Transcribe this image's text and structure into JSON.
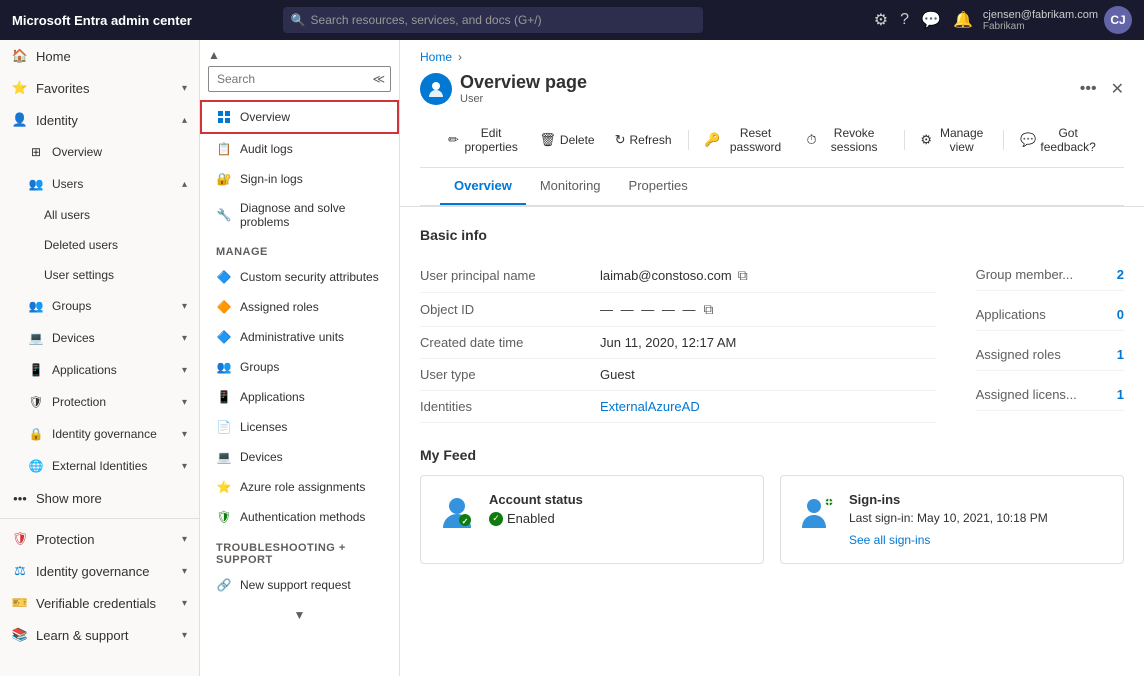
{
  "app": {
    "title": "Microsoft Entra admin center"
  },
  "topbar": {
    "title": "Microsoft Entra admin center",
    "search_placeholder": "Search resources, services, and docs (G+/)",
    "user_name": "cjensen@fabrikam.com",
    "user_org": "Fabrikam",
    "user_initials": "CJ"
  },
  "sidebar": {
    "items": [
      {
        "id": "home",
        "label": "Home",
        "icon": "home",
        "active": false
      },
      {
        "id": "favorites",
        "label": "Favorites",
        "icon": "star",
        "expandable": true
      },
      {
        "id": "identity",
        "label": "Identity",
        "icon": "id",
        "expandable": true,
        "expanded": true
      },
      {
        "id": "overview",
        "label": "Overview",
        "icon": "grid",
        "sub": true
      },
      {
        "id": "users",
        "label": "Users",
        "icon": "person",
        "expandable": true,
        "expanded": true,
        "sub": true
      },
      {
        "id": "all-users",
        "label": "All users",
        "sub2": true
      },
      {
        "id": "deleted-users",
        "label": "Deleted users",
        "sub2": true
      },
      {
        "id": "user-settings",
        "label": "User settings",
        "sub2": true
      },
      {
        "id": "groups",
        "label": "Groups",
        "icon": "group",
        "expandable": true,
        "sub": true
      },
      {
        "id": "devices",
        "label": "Devices",
        "icon": "device",
        "expandable": true,
        "sub": true
      },
      {
        "id": "applications",
        "label": "Applications",
        "icon": "app",
        "expandable": true,
        "sub": true
      },
      {
        "id": "protection",
        "label": "Protection",
        "icon": "shield",
        "expandable": true,
        "sub": true
      },
      {
        "id": "identity-governance",
        "label": "Identity governance",
        "icon": "gov",
        "expandable": true,
        "sub": true
      },
      {
        "id": "external-identities",
        "label": "External Identities",
        "icon": "ext",
        "expandable": true,
        "sub": true
      },
      {
        "id": "show-more",
        "label": "Show more",
        "icon": "more"
      },
      {
        "id": "protection2",
        "label": "Protection",
        "icon": "shield2",
        "expandable": true
      },
      {
        "id": "identity-governance2",
        "label": "Identity governance",
        "icon": "gov2",
        "expandable": true
      },
      {
        "id": "verifiable-credentials",
        "label": "Verifiable credentials",
        "icon": "cred",
        "expandable": true
      },
      {
        "id": "learn-support",
        "label": "Learn & support",
        "icon": "learn",
        "expandable": true
      }
    ]
  },
  "secondary_nav": {
    "search_placeholder": "Search",
    "items": [
      {
        "id": "overview",
        "label": "Overview",
        "selected": true,
        "highlighted": true
      },
      {
        "id": "audit-logs",
        "label": "Audit logs"
      },
      {
        "id": "sign-in-logs",
        "label": "Sign-in logs"
      },
      {
        "id": "diagnose",
        "label": "Diagnose and solve problems"
      }
    ],
    "manage_section": "Manage",
    "manage_items": [
      {
        "id": "custom-security",
        "label": "Custom security attributes"
      },
      {
        "id": "assigned-roles",
        "label": "Assigned roles"
      },
      {
        "id": "admin-units",
        "label": "Administrative units"
      },
      {
        "id": "groups",
        "label": "Groups"
      },
      {
        "id": "applications",
        "label": "Applications"
      },
      {
        "id": "licenses",
        "label": "Licenses"
      },
      {
        "id": "devices",
        "label": "Devices"
      },
      {
        "id": "azure-role",
        "label": "Azure role assignments"
      },
      {
        "id": "auth-methods",
        "label": "Authentication methods"
      }
    ],
    "troubleshoot_section": "Troubleshooting + Support",
    "troubleshoot_items": [
      {
        "id": "new-support",
        "label": "New support request"
      }
    ]
  },
  "breadcrumb": {
    "items": [
      "Home"
    ]
  },
  "page": {
    "title": "Overview page",
    "subtitle": "User",
    "tabs": [
      {
        "id": "overview",
        "label": "Overview",
        "active": true
      },
      {
        "id": "monitoring",
        "label": "Monitoring"
      },
      {
        "id": "properties",
        "label": "Properties"
      }
    ]
  },
  "toolbar": {
    "buttons": [
      {
        "id": "edit-properties",
        "label": "Edit properties",
        "icon": "✏"
      },
      {
        "id": "delete",
        "label": "Delete",
        "icon": "🗑"
      },
      {
        "id": "refresh",
        "label": "Refresh",
        "icon": "↻"
      },
      {
        "id": "reset-password",
        "label": "Reset password",
        "icon": "🔑"
      },
      {
        "id": "revoke-sessions",
        "label": "Revoke sessions",
        "icon": "⏱"
      },
      {
        "id": "manage-view",
        "label": "Manage view",
        "icon": "⚙"
      },
      {
        "id": "got-feedback",
        "label": "Got feedback?",
        "icon": "💬"
      }
    ]
  },
  "basic_info": {
    "title": "Basic info",
    "fields": [
      {
        "id": "upn",
        "label": "User principal name",
        "value": "laimab@constoso.com",
        "copyable": true
      },
      {
        "id": "object-id",
        "label": "Object ID",
        "value": "— — — — —",
        "copyable": true,
        "masked": true
      },
      {
        "id": "created-date",
        "label": "Created date time",
        "value": "Jun 11, 2020, 12:17 AM"
      },
      {
        "id": "user-type",
        "label": "User type",
        "value": "Guest"
      },
      {
        "id": "identities",
        "label": "Identities",
        "value": "ExternalAzureAD",
        "link": true
      }
    ],
    "stats": [
      {
        "id": "group-member",
        "label": "Group member...",
        "value": "2"
      },
      {
        "id": "applications",
        "label": "Applications",
        "value": "0"
      },
      {
        "id": "assigned-roles",
        "label": "Assigned roles",
        "value": "1"
      },
      {
        "id": "assigned-licenses",
        "label": "Assigned licens...",
        "value": "1"
      }
    ]
  },
  "feed": {
    "title": "My Feed",
    "cards": [
      {
        "id": "account-status",
        "title": "Account status",
        "status": "Enabled",
        "status_icon": "✓"
      },
      {
        "id": "sign-ins",
        "title": "Sign-ins",
        "subtitle": "Last sign-in: May 10, 2021, 10:18 PM",
        "link": "See all sign-ins"
      }
    ]
  }
}
